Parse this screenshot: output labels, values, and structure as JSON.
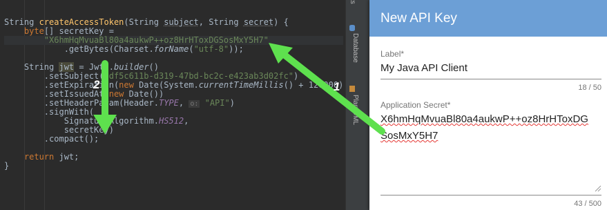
{
  "editor": {
    "lines": [
      {
        "parts": [
          {
            "t": "String ",
            "c": "type"
          },
          {
            "t": "createAccessToken",
            "c": "fn"
          },
          {
            "t": "(String ",
            "c": "type"
          },
          {
            "t": "subject",
            "c": "param"
          },
          {
            "t": ", String ",
            "c": "type"
          },
          {
            "t": "secret",
            "c": "param"
          },
          {
            "t": ") {",
            "c": ""
          }
        ]
      },
      {
        "parts": [
          {
            "t": "    ",
            "c": ""
          },
          {
            "t": "byte",
            "c": "kw"
          },
          {
            "t": "[] secretKey =",
            "c": ""
          }
        ]
      },
      {
        "hl": true,
        "parts": [
          {
            "t": "        ",
            "c": ""
          },
          {
            "t": "\"X6hmHqMvuaBl80a4aukwP++oz8HrHToxDGSosMxY5H7\"",
            "c": "str"
          }
        ]
      },
      {
        "parts": [
          {
            "t": "            .getBytes(Charset.",
            "c": ""
          },
          {
            "t": "forName",
            "c": "it"
          },
          {
            "t": "(",
            "c": ""
          },
          {
            "t": "\"utf-8\"",
            "c": "str"
          },
          {
            "t": "));",
            "c": ""
          }
        ]
      },
      {
        "parts": [
          {
            "t": "",
            "c": ""
          }
        ]
      },
      {
        "parts": [
          {
            "t": "    String ",
            "c": ""
          },
          {
            "t": "jwt",
            "c": "jwtvar"
          },
          {
            "t": " = Jwts.",
            "c": ""
          },
          {
            "t": "builder",
            "c": "it"
          },
          {
            "t": "()",
            "c": ""
          }
        ]
      },
      {
        "parts": [
          {
            "t": "        .setSubject(",
            "c": ""
          },
          {
            "t": "\"df5c611b-d319-47bd-bc2c-e423ab3d02fc\"",
            "c": "str"
          },
          {
            "t": ")",
            "c": ""
          }
        ]
      },
      {
        "parts": [
          {
            "t": "        .setExpiration(",
            "c": ""
          },
          {
            "t": "new ",
            "c": "kw"
          },
          {
            "t": "Date(System.",
            "c": ""
          },
          {
            "t": "currentTimeMillis",
            "c": "it"
          },
          {
            "t": "() + 120000)",
            "c": ""
          }
        ]
      },
      {
        "parts": [
          {
            "t": "        .setIssuedAt(",
            "c": ""
          },
          {
            "t": "new ",
            "c": "kw"
          },
          {
            "t": "Date())",
            "c": ""
          }
        ]
      },
      {
        "parts": [
          {
            "t": "        .setHeaderParam(Header.",
            "c": ""
          },
          {
            "t": "TYPE",
            "c": "sfield"
          },
          {
            "t": ", ",
            "c": ""
          },
          {
            "t": "o:",
            "c": "hint"
          },
          {
            "t": " ",
            "c": ""
          },
          {
            "t": "\"API\"",
            "c": "str"
          },
          {
            "t": ")",
            "c": ""
          }
        ]
      },
      {
        "parts": [
          {
            "t": "        .signWith(",
            "c": ""
          }
        ]
      },
      {
        "parts": [
          {
            "t": "            SignatureAlgorithm.",
            "c": ""
          },
          {
            "t": "HS512",
            "c": "sfield"
          },
          {
            "t": ",",
            "c": ""
          }
        ]
      },
      {
        "parts": [
          {
            "t": "            secretKey)",
            "c": ""
          }
        ]
      },
      {
        "parts": [
          {
            "t": "        .compact();",
            "c": ""
          }
        ]
      },
      {
        "parts": [
          {
            "t": "",
            "c": ""
          }
        ]
      },
      {
        "parts": [
          {
            "t": "    ",
            "c": ""
          },
          {
            "t": "return ",
            "c": "kw"
          },
          {
            "t": "jwt;",
            "c": ""
          }
        ]
      },
      {
        "parts": [
          {
            "t": "}",
            "c": ""
          }
        ]
      }
    ]
  },
  "toolstrip": {
    "top_label": "ts",
    "database_label": "Database",
    "plantuml_label": "PlantUML"
  },
  "dialog": {
    "title": "New API Key",
    "label_field": {
      "label": "Label*",
      "value": "My Java API Client",
      "counter": "18 / 50"
    },
    "secret_field": {
      "label": "Application Secret*",
      "value_line1": "X6hmHqMvuaBl80a4aukwP++oz8HrHToxDG",
      "value_line2": "SosMxY5H7",
      "counter": "43 / 500"
    }
  },
  "annotations": {
    "arrow1_number": "1",
    "arrow2_number": "2",
    "color": "#5ee04e"
  }
}
